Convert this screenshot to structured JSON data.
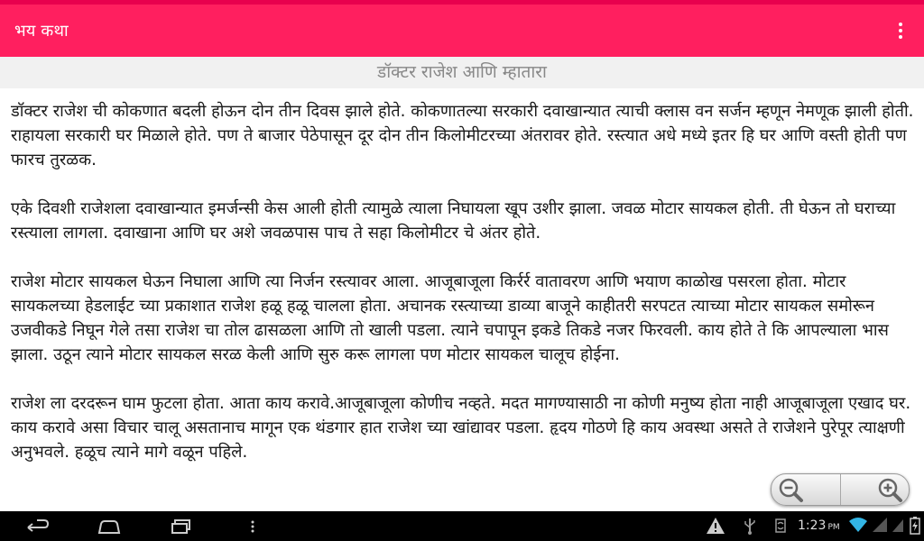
{
  "app": {
    "title": "भय कथा"
  },
  "story": {
    "title": "डॉक्टर राजेश आणि म्हातारा",
    "paragraphs": [
      "डॉक्टर राजेश ची कोकणात बदली होऊन दोन तीन दिवस झाले होते. कोकणातल्या सरकारी दवाखान्यात त्याची क्लास वन सर्जन म्हणून नेमणूक झाली होती. राहायला सरकारी घर मिळाले होते. पण ते बाजार पेठेपासून दूर दोन तीन किलोमीटरच्या अंतरावर होते. रस्त्यात अधे मध्ये इतर हि घर आणि वस्ती होती पण फारच तुरळक.",
      "एके दिवशी राजेशला दवाखान्यात इमर्जन्सी केस आली होती त्यामुळे त्याला निघायला खूप उशीर झाला. जवळ मोटार सायकल होती. ती घेऊन तो घराच्या रस्त्याला लागला. दवाखाना आणि घर अशे जवळपास पाच ते सहा किलोमीटर चे अंतर होते.",
      "राजेश मोटार सायकल घेऊन निघाला आणि त्या निर्जन रस्त्यावर आला. आजूबाजूला किर्रर्र वातावरण आणि भयाण काळोख पसरला होता. मोटार सायकलच्या हेडलाईट च्या प्रकाशात राजेश हळू हळू चालला होता. अचानक रस्त्याच्या डाव्या बाजूने काहीतरी सरपटत त्याच्या मोटार सायकल समोरून उजवीकडे निघून गेले तसा राजेश चा तोल ढासळला आणि तो खाली पडला. त्याने चपापून इकडे तिकडे नजर फिरवली. काय होते ते कि आपल्याला भास झाला. उठून त्याने मोटार सायकल सरळ केली आणि सुरु करू लागला पण मोटार सायकल चालूच होईना.",
      "राजेश ला दरदरून घाम फुटला होता. आता काय करावे.आजूबाजूला कोणीच नव्हते. मदत मागण्यासाठी ना कोणी मनुष्य होता नाही आजूबाजूला एखाद घर. काय करावे असा विचार चालू असतानाच मागून एक थंडगार हात राजेश च्या खांद्यावर पडला. हृदय गोठणे हि काय अवस्था असते ते राजेशने पुरेपूर त्याक्षणी अनुभवले. हळूच त्याने मागे वळून पहिले."
    ]
  },
  "status": {
    "time": "1:23",
    "ampm": "PM"
  },
  "icons": {
    "overflow": "more-vert-icon",
    "zoom_out": "zoom-out-icon",
    "zoom_in": "zoom-in-icon",
    "nav_back": "back-icon",
    "nav_home": "home-icon",
    "nav_recents": "recents-icon",
    "nav_menu": "menu-dots-icon",
    "warning": "warning-icon",
    "usb": "usb-icon",
    "sync": "sync-icon",
    "wifi": "wifi-icon",
    "signal": "signal-icon",
    "battery": "battery-icon"
  },
  "colors": {
    "appbar": "#ff1f5f",
    "statusbar": "#e8004e",
    "title_bar_bg": "#f1f1f1",
    "title_text": "#888888",
    "body_text": "#1a1a1a",
    "navbar": "#000000",
    "wifi": "#33b5e5"
  }
}
